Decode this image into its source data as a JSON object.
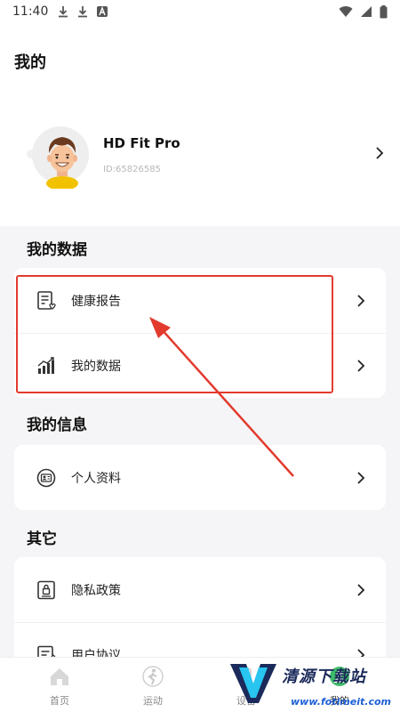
{
  "status_bar": {
    "time": "11:40",
    "left_icons": [
      "download-icon",
      "download-icon",
      "notification-a-icon"
    ],
    "right_icons": [
      "wifi-icon",
      "signal-icon",
      "battery-icon"
    ]
  },
  "page": {
    "title": "我的"
  },
  "profile": {
    "name": "HD Fit Pro",
    "id_text": "ID:65826585",
    "avatar": "cartoon-avatar-icon"
  },
  "sections": {
    "my_data": {
      "title": "我的数据",
      "items": [
        {
          "label": "健康报告",
          "icon": "health-report-icon"
        },
        {
          "label": "我的数据",
          "icon": "bar-chart-icon"
        }
      ]
    },
    "my_info": {
      "title": "我的信息",
      "items": [
        {
          "label": "个人资料",
          "icon": "profile-card-icon"
        }
      ]
    },
    "other": {
      "title": "其它",
      "items": [
        {
          "label": "隐私政策",
          "icon": "privacy-lock-icon"
        },
        {
          "label": "用户协议",
          "icon": "agreement-icon"
        }
      ]
    }
  },
  "tabbar": {
    "tabs": [
      {
        "label": "首页",
        "icon": "home-icon"
      },
      {
        "label": "运动",
        "icon": "running-icon"
      },
      {
        "label": "设备",
        "icon": "device-icon"
      },
      {
        "label": "我的",
        "icon": "user-icon"
      }
    ]
  },
  "annotation": {
    "color": "#e23b2e"
  },
  "watermark": {
    "text": "清源下载站",
    "url": "www.fotimeit.com"
  },
  "colors": {
    "background": "#f5f5f7",
    "card": "#ffffff",
    "text": "#222222",
    "muted": "#b8b8b8"
  }
}
